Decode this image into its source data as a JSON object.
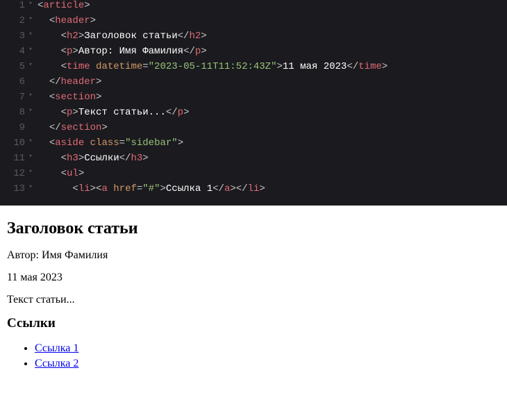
{
  "editor": {
    "lines": [
      {
        "n": 1,
        "fold": "▾",
        "indent": 0,
        "tokens": [
          {
            "c": "punct",
            "t": "<"
          },
          {
            "c": "tagname",
            "t": "article"
          },
          {
            "c": "punct",
            "t": ">"
          }
        ]
      },
      {
        "n": 2,
        "fold": "▾",
        "indent": 1,
        "tokens": [
          {
            "c": "punct",
            "t": "<"
          },
          {
            "c": "tagname",
            "t": "header"
          },
          {
            "c": "punct",
            "t": ">"
          }
        ]
      },
      {
        "n": 3,
        "fold": "▾",
        "indent": 2,
        "tokens": [
          {
            "c": "punct",
            "t": "<"
          },
          {
            "c": "tagname",
            "t": "h2"
          },
          {
            "c": "punct",
            "t": ">"
          },
          {
            "c": "text",
            "t": "Заголовок статьи"
          },
          {
            "c": "punct",
            "t": "</"
          },
          {
            "c": "tagname",
            "t": "h2"
          },
          {
            "c": "punct",
            "t": ">"
          }
        ]
      },
      {
        "n": 4,
        "fold": "▾",
        "indent": 2,
        "tokens": [
          {
            "c": "punct",
            "t": "<"
          },
          {
            "c": "tagname",
            "t": "p"
          },
          {
            "c": "punct",
            "t": ">"
          },
          {
            "c": "text",
            "t": "Автор: Имя Фамилия"
          },
          {
            "c": "punct",
            "t": "</"
          },
          {
            "c": "tagname",
            "t": "p"
          },
          {
            "c": "punct",
            "t": ">"
          }
        ]
      },
      {
        "n": 5,
        "fold": "▾",
        "indent": 2,
        "tokens": [
          {
            "c": "punct",
            "t": "<"
          },
          {
            "c": "tagname",
            "t": "time"
          },
          {
            "c": "punct",
            "t": " "
          },
          {
            "c": "attr",
            "t": "datetime"
          },
          {
            "c": "eq",
            "t": "="
          },
          {
            "c": "str",
            "t": "\"2023-05-11T11:52:43Z\""
          },
          {
            "c": "punct",
            "t": ">"
          },
          {
            "c": "text",
            "t": "11 мая 2023"
          },
          {
            "c": "punct",
            "t": "</"
          },
          {
            "c": "tagname",
            "t": "time"
          },
          {
            "c": "punct",
            "t": ">"
          }
        ]
      },
      {
        "n": 6,
        "fold": "",
        "indent": 1,
        "tokens": [
          {
            "c": "punct",
            "t": "</"
          },
          {
            "c": "tagname",
            "t": "header"
          },
          {
            "c": "punct",
            "t": ">"
          }
        ]
      },
      {
        "n": 7,
        "fold": "▾",
        "indent": 1,
        "tokens": [
          {
            "c": "punct",
            "t": "<"
          },
          {
            "c": "tagname",
            "t": "section"
          },
          {
            "c": "punct",
            "t": ">"
          }
        ]
      },
      {
        "n": 8,
        "fold": "▾",
        "indent": 2,
        "tokens": [
          {
            "c": "punct",
            "t": "<"
          },
          {
            "c": "tagname",
            "t": "p"
          },
          {
            "c": "punct",
            "t": ">"
          },
          {
            "c": "text",
            "t": "Текст статьи..."
          },
          {
            "c": "punct",
            "t": "</"
          },
          {
            "c": "tagname",
            "t": "p"
          },
          {
            "c": "punct",
            "t": ">"
          }
        ]
      },
      {
        "n": 9,
        "fold": "",
        "indent": 1,
        "tokens": [
          {
            "c": "punct",
            "t": "</"
          },
          {
            "c": "tagname",
            "t": "section"
          },
          {
            "c": "punct",
            "t": ">"
          }
        ]
      },
      {
        "n": 10,
        "fold": "▾",
        "indent": 1,
        "tokens": [
          {
            "c": "punct",
            "t": "<"
          },
          {
            "c": "tagname",
            "t": "aside"
          },
          {
            "c": "punct",
            "t": " "
          },
          {
            "c": "attr",
            "t": "class"
          },
          {
            "c": "eq",
            "t": "="
          },
          {
            "c": "str",
            "t": "\"sidebar\""
          },
          {
            "c": "punct",
            "t": ">"
          }
        ]
      },
      {
        "n": 11,
        "fold": "▾",
        "indent": 2,
        "tokens": [
          {
            "c": "punct",
            "t": "<"
          },
          {
            "c": "tagname",
            "t": "h3"
          },
          {
            "c": "punct",
            "t": ">"
          },
          {
            "c": "text",
            "t": "Ссылки"
          },
          {
            "c": "punct",
            "t": "</"
          },
          {
            "c": "tagname",
            "t": "h3"
          },
          {
            "c": "punct",
            "t": ">"
          }
        ]
      },
      {
        "n": 12,
        "fold": "▾",
        "indent": 2,
        "tokens": [
          {
            "c": "punct",
            "t": "<"
          },
          {
            "c": "tagname",
            "t": "ul"
          },
          {
            "c": "punct",
            "t": ">"
          }
        ]
      },
      {
        "n": 13,
        "fold": "▾",
        "indent": 3,
        "tokens": [
          {
            "c": "punct",
            "t": "<"
          },
          {
            "c": "tagname",
            "t": "li"
          },
          {
            "c": "punct",
            "t": "><"
          },
          {
            "c": "tagname",
            "t": "a"
          },
          {
            "c": "punct",
            "t": " "
          },
          {
            "c": "attr",
            "t": "href"
          },
          {
            "c": "eq",
            "t": "="
          },
          {
            "c": "str",
            "t": "\"#\""
          },
          {
            "c": "punct",
            "t": ">"
          },
          {
            "c": "text",
            "t": "Ссылка 1"
          },
          {
            "c": "punct",
            "t": "</"
          },
          {
            "c": "tagname",
            "t": "a"
          },
          {
            "c": "punct",
            "t": "></"
          },
          {
            "c": "tagname",
            "t": "li"
          },
          {
            "c": "punct",
            "t": ">"
          }
        ]
      }
    ]
  },
  "preview": {
    "title": "Заголовок статьи",
    "author": "Автор: Имя Фамилия",
    "date": "11 мая 2023",
    "body": "Текст статьи...",
    "links_heading": "Ссылки",
    "links": [
      {
        "label": "Ссылка 1"
      },
      {
        "label": "Ссылка 2"
      }
    ]
  }
}
